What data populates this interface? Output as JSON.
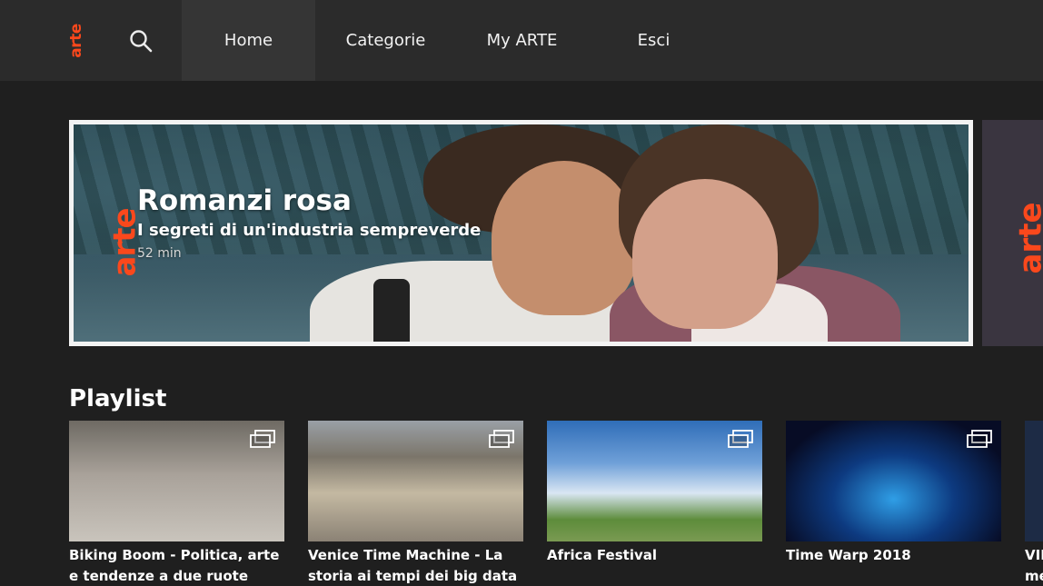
{
  "brand": {
    "logo_text": "arte",
    "accent_color": "#fa481c"
  },
  "nav": {
    "search_icon": "search-icon",
    "items": [
      {
        "label": "Home",
        "active": true
      },
      {
        "label": "Categorie",
        "active": false
      },
      {
        "label": "My ARTE",
        "active": false
      },
      {
        "label": "Esci",
        "active": false
      }
    ]
  },
  "hero": {
    "brand_text": "arte",
    "title": "Romanzi rosa",
    "subtitle": "I segreti di un'industria sempreverde",
    "duration": "52 min"
  },
  "hero_next": {
    "brand_text": "arte"
  },
  "playlist": {
    "heading": "Playlist",
    "cards": [
      {
        "title": "Biking Boom - Politica, arte e tendenze a due ruote",
        "icon": "playlist-stack-icon"
      },
      {
        "title": "Venice Time Machine - La storia ai tempi dei big data",
        "icon": "playlist-stack-icon"
      },
      {
        "title": "Africa Festival",
        "icon": "playlist-stack-icon"
      },
      {
        "title": "Time Warp 2018",
        "icon": "playlist-stack-icon"
      },
      {
        "title": "VII me"
      }
    ]
  }
}
